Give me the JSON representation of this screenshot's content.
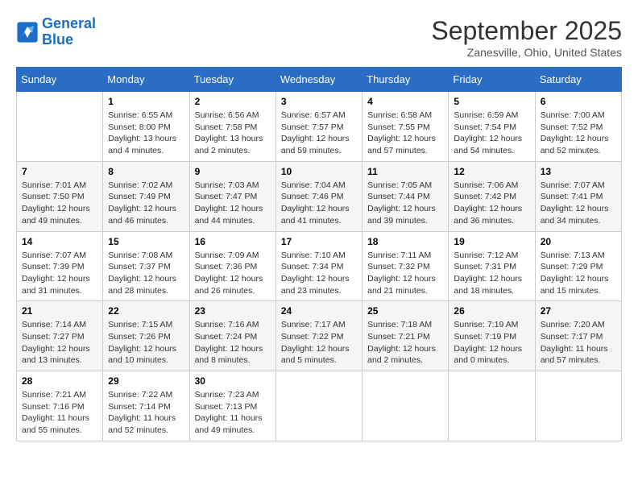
{
  "logo": {
    "line1": "General",
    "line2": "Blue"
  },
  "title": "September 2025",
  "subtitle": "Zanesville, Ohio, United States",
  "days_of_week": [
    "Sunday",
    "Monday",
    "Tuesday",
    "Wednesday",
    "Thursday",
    "Friday",
    "Saturday"
  ],
  "weeks": [
    [
      {
        "day": "",
        "info": ""
      },
      {
        "day": "1",
        "info": "Sunrise: 6:55 AM\nSunset: 8:00 PM\nDaylight: 13 hours\nand 4 minutes."
      },
      {
        "day": "2",
        "info": "Sunrise: 6:56 AM\nSunset: 7:58 PM\nDaylight: 13 hours\nand 2 minutes."
      },
      {
        "day": "3",
        "info": "Sunrise: 6:57 AM\nSunset: 7:57 PM\nDaylight: 12 hours\nand 59 minutes."
      },
      {
        "day": "4",
        "info": "Sunrise: 6:58 AM\nSunset: 7:55 PM\nDaylight: 12 hours\nand 57 minutes."
      },
      {
        "day": "5",
        "info": "Sunrise: 6:59 AM\nSunset: 7:54 PM\nDaylight: 12 hours\nand 54 minutes."
      },
      {
        "day": "6",
        "info": "Sunrise: 7:00 AM\nSunset: 7:52 PM\nDaylight: 12 hours\nand 52 minutes."
      }
    ],
    [
      {
        "day": "7",
        "info": "Sunrise: 7:01 AM\nSunset: 7:50 PM\nDaylight: 12 hours\nand 49 minutes."
      },
      {
        "day": "8",
        "info": "Sunrise: 7:02 AM\nSunset: 7:49 PM\nDaylight: 12 hours\nand 46 minutes."
      },
      {
        "day": "9",
        "info": "Sunrise: 7:03 AM\nSunset: 7:47 PM\nDaylight: 12 hours\nand 44 minutes."
      },
      {
        "day": "10",
        "info": "Sunrise: 7:04 AM\nSunset: 7:46 PM\nDaylight: 12 hours\nand 41 minutes."
      },
      {
        "day": "11",
        "info": "Sunrise: 7:05 AM\nSunset: 7:44 PM\nDaylight: 12 hours\nand 39 minutes."
      },
      {
        "day": "12",
        "info": "Sunrise: 7:06 AM\nSunset: 7:42 PM\nDaylight: 12 hours\nand 36 minutes."
      },
      {
        "day": "13",
        "info": "Sunrise: 7:07 AM\nSunset: 7:41 PM\nDaylight: 12 hours\nand 34 minutes."
      }
    ],
    [
      {
        "day": "14",
        "info": "Sunrise: 7:07 AM\nSunset: 7:39 PM\nDaylight: 12 hours\nand 31 minutes."
      },
      {
        "day": "15",
        "info": "Sunrise: 7:08 AM\nSunset: 7:37 PM\nDaylight: 12 hours\nand 28 minutes."
      },
      {
        "day": "16",
        "info": "Sunrise: 7:09 AM\nSunset: 7:36 PM\nDaylight: 12 hours\nand 26 minutes."
      },
      {
        "day": "17",
        "info": "Sunrise: 7:10 AM\nSunset: 7:34 PM\nDaylight: 12 hours\nand 23 minutes."
      },
      {
        "day": "18",
        "info": "Sunrise: 7:11 AM\nSunset: 7:32 PM\nDaylight: 12 hours\nand 21 minutes."
      },
      {
        "day": "19",
        "info": "Sunrise: 7:12 AM\nSunset: 7:31 PM\nDaylight: 12 hours\nand 18 minutes."
      },
      {
        "day": "20",
        "info": "Sunrise: 7:13 AM\nSunset: 7:29 PM\nDaylight: 12 hours\nand 15 minutes."
      }
    ],
    [
      {
        "day": "21",
        "info": "Sunrise: 7:14 AM\nSunset: 7:27 PM\nDaylight: 12 hours\nand 13 minutes."
      },
      {
        "day": "22",
        "info": "Sunrise: 7:15 AM\nSunset: 7:26 PM\nDaylight: 12 hours\nand 10 minutes."
      },
      {
        "day": "23",
        "info": "Sunrise: 7:16 AM\nSunset: 7:24 PM\nDaylight: 12 hours\nand 8 minutes."
      },
      {
        "day": "24",
        "info": "Sunrise: 7:17 AM\nSunset: 7:22 PM\nDaylight: 12 hours\nand 5 minutes."
      },
      {
        "day": "25",
        "info": "Sunrise: 7:18 AM\nSunset: 7:21 PM\nDaylight: 12 hours\nand 2 minutes."
      },
      {
        "day": "26",
        "info": "Sunrise: 7:19 AM\nSunset: 7:19 PM\nDaylight: 12 hours\nand 0 minutes."
      },
      {
        "day": "27",
        "info": "Sunrise: 7:20 AM\nSunset: 7:17 PM\nDaylight: 11 hours\nand 57 minutes."
      }
    ],
    [
      {
        "day": "28",
        "info": "Sunrise: 7:21 AM\nSunset: 7:16 PM\nDaylight: 11 hours\nand 55 minutes."
      },
      {
        "day": "29",
        "info": "Sunrise: 7:22 AM\nSunset: 7:14 PM\nDaylight: 11 hours\nand 52 minutes."
      },
      {
        "day": "30",
        "info": "Sunrise: 7:23 AM\nSunset: 7:13 PM\nDaylight: 11 hours\nand 49 minutes."
      },
      {
        "day": "",
        "info": ""
      },
      {
        "day": "",
        "info": ""
      },
      {
        "day": "",
        "info": ""
      },
      {
        "day": "",
        "info": ""
      }
    ]
  ]
}
